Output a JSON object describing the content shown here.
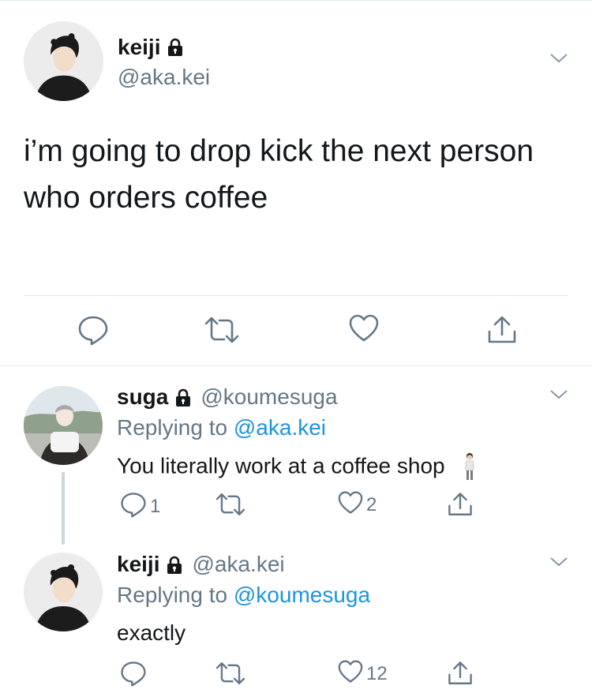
{
  "main_tweet": {
    "name": "keiji",
    "handle": "@aka.kei",
    "text": "i’m going to drop kick the next person who orders coffee"
  },
  "replies": [
    {
      "name": "suga",
      "handle": "@koumesuga",
      "replying_prefix": "Replying to ",
      "replying_to": "@aka.kei",
      "text": "You literally work at a coffee shop",
      "reply_count": "1",
      "like_count": "2"
    },
    {
      "name": "keiji",
      "handle": "@aka.kei",
      "replying_prefix": "Replying to ",
      "replying_to": "@koumesuga",
      "text": "exactly",
      "reply_count": "",
      "like_count": "12"
    }
  ],
  "icons": {
    "reply": "reply-icon",
    "retweet": "retweet-icon",
    "like": "heart-icon",
    "share": "share-icon",
    "lock": "lock-icon",
    "chevron": "chevron-down-icon",
    "emoji": "person-standing-emoji"
  },
  "colors": {
    "text": "#14171a",
    "secondary": "#657786",
    "link": "#1b95e0",
    "divider": "#e1e8ed",
    "thread_line": "#ccd6dd"
  }
}
